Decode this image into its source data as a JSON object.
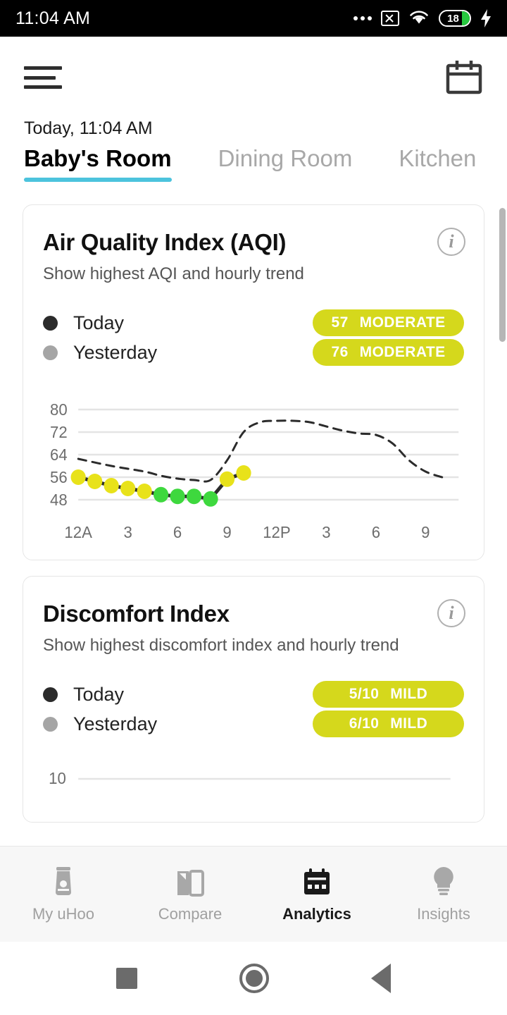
{
  "status_bar": {
    "time": "11:04 AM",
    "battery_level": "18",
    "icons": [
      "more-dots-icon",
      "no-sim-icon",
      "wifi-icon",
      "battery-icon",
      "charging-bolt-icon"
    ]
  },
  "header": {
    "menu_icon": "hamburger-menu-icon",
    "calendar_icon": "calendar-icon",
    "date_label": "Today, 11:04 AM"
  },
  "tabs": [
    {
      "label": "Baby's Room",
      "active": true
    },
    {
      "label": "Dining Room",
      "active": false
    },
    {
      "label": "Kitchen",
      "active": false
    }
  ],
  "cards": [
    {
      "title": "Air Quality Index (AQI)",
      "subtitle": "Show highest AQI and hourly trend",
      "info_icon": "info-icon",
      "legend": [
        {
          "label": "Today",
          "badge_value": "57",
          "badge_status": "MODERATE"
        },
        {
          "label": "Yesterday",
          "badge_value": "76",
          "badge_status": "MODERATE"
        }
      ]
    },
    {
      "title": "Discomfort Index",
      "subtitle": "Show highest discomfort index and hourly trend",
      "info_icon": "info-icon",
      "legend": [
        {
          "label": "Today",
          "badge_value": "5/10",
          "badge_status": "MILD"
        },
        {
          "label": "Yesterday",
          "badge_value": "6/10",
          "badge_status": "MILD"
        }
      ]
    }
  ],
  "bottom_nav": [
    {
      "label": "My uHoo",
      "icon": "device-icon",
      "active": false
    },
    {
      "label": "Compare",
      "icon": "compare-cards-icon",
      "active": false
    },
    {
      "label": "Analytics",
      "icon": "analytics-calendar-icon",
      "active": true
    },
    {
      "label": "Insights",
      "icon": "lightbulb-icon",
      "active": false
    }
  ],
  "android_nav": [
    "recents-square-icon",
    "home-circle-icon",
    "back-triangle-icon"
  ],
  "colors": {
    "accent_tab_underline": "#4cc3dd",
    "badge_yellow": "#d5d81c",
    "point_yellow": "#e8e21a",
    "point_green": "#3ed83e",
    "today_line": "#2b2b2b",
    "yesterday_line": "#2b2b2b",
    "grid": "#e4e4e4"
  },
  "chart_data": [
    {
      "type": "line",
      "title": "Air Quality Index (AQI)",
      "ylabel": "",
      "xlabel": "",
      "ylim": [
        44,
        84
      ],
      "yticks": [
        48,
        56,
        64,
        72,
        80
      ],
      "xticks": [
        "12A",
        "3",
        "6",
        "9",
        "12P",
        "3",
        "6",
        "9"
      ],
      "xtick_hours": [
        0,
        3,
        6,
        9,
        12,
        15,
        18,
        21
      ],
      "grid": true,
      "legend": [
        "Today",
        "Yesterday"
      ],
      "series": [
        {
          "name": "Today",
          "style": "solid-with-markers",
          "x": [
            0,
            1,
            2,
            3,
            4,
            5,
            6,
            7,
            8,
            9,
            10
          ],
          "values": [
            56,
            54.5,
            53,
            52,
            51,
            49.8,
            49.2,
            49.2,
            48.3,
            55.3,
            57.5
          ],
          "marker_colors": [
            "yellow",
            "yellow",
            "yellow",
            "yellow",
            "yellow",
            "green",
            "green",
            "green",
            "green",
            "yellow",
            "yellow"
          ],
          "peak": 57
        },
        {
          "name": "Yesterday",
          "style": "dashed",
          "x": [
            0,
            2,
            4,
            5,
            6,
            7,
            8,
            9,
            10,
            11,
            12,
            13,
            14,
            15,
            16,
            17,
            18,
            19,
            20,
            21,
            22
          ],
          "values": [
            62.5,
            60,
            58,
            56.5,
            55.5,
            55,
            55,
            62,
            72,
            75.5,
            76,
            76,
            75.5,
            74,
            72.5,
            71.5,
            71,
            68,
            62,
            58,
            56
          ],
          "peak": 76
        }
      ]
    },
    {
      "type": "line",
      "title": "Discomfort Index",
      "ylim": [
        0,
        10
      ],
      "yticks": [
        10
      ],
      "grid": true,
      "legend": [
        "Today",
        "Yesterday"
      ],
      "series": [
        {
          "name": "Today",
          "style": "solid-with-markers",
          "peak": 5
        },
        {
          "name": "Yesterday",
          "style": "dashed",
          "peak": 6
        }
      ],
      "note": "clipped by bottom navigation bar"
    }
  ]
}
